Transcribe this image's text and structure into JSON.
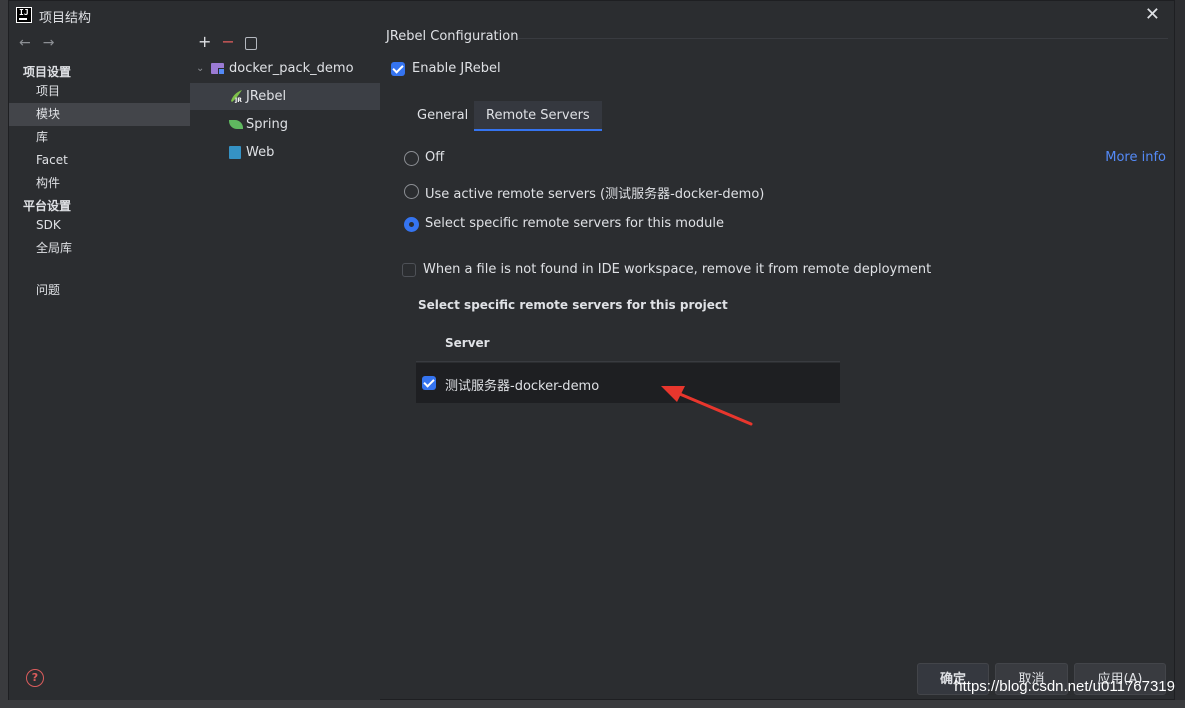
{
  "window": {
    "title": "项目结构",
    "logo_text": "IJ"
  },
  "leftnav": {
    "sections": [
      {
        "label": "项目设置"
      },
      {
        "label": "平台设置"
      }
    ],
    "items": [
      {
        "label": "项目"
      },
      {
        "label": "模块"
      },
      {
        "label": "库"
      },
      {
        "label": "Facet"
      },
      {
        "label": "构件"
      },
      {
        "label": "SDK"
      },
      {
        "label": "全局库"
      },
      {
        "label": "问题"
      }
    ],
    "selected": "模块",
    "help_icon": "?"
  },
  "tree": {
    "toolbar": {
      "add": "+",
      "remove": "−"
    },
    "root": {
      "label": "docker_pack_demo"
    },
    "children": [
      {
        "label": "JRebel"
      },
      {
        "label": "Spring"
      },
      {
        "label": "Web"
      }
    ],
    "selected": "JRebel"
  },
  "config": {
    "group_title": "JRebel Configuration",
    "enable_label": "Enable JRebel",
    "enable_checked": true,
    "tabs": [
      {
        "label": "General"
      },
      {
        "label": "Remote Servers"
      }
    ],
    "active_tab": "Remote Servers",
    "more_info": "More info",
    "radios": [
      {
        "label": "Off",
        "selected": false
      },
      {
        "label": "Use active remote servers (测试服务器-docker-demo)",
        "selected": false
      },
      {
        "label": "Select specific remote servers for this module",
        "selected": true
      }
    ],
    "remove_option": {
      "label": "When a file is not found in IDE workspace, remove it from remote deployment",
      "checked": false
    },
    "servers_heading": "Select specific remote servers for this project",
    "table": {
      "column": "Server",
      "rows": [
        {
          "name": "测试服务器-docker-demo",
          "checked": true
        }
      ]
    }
  },
  "footer": {
    "ok": "确定",
    "cancel": "取消",
    "apply": "应用(A)"
  },
  "watermark": "https://blog.csdn.net/u011767319",
  "colors": {
    "accent": "#3574f0",
    "link": "#548af7",
    "annotation_arrow": "#e8362d"
  }
}
